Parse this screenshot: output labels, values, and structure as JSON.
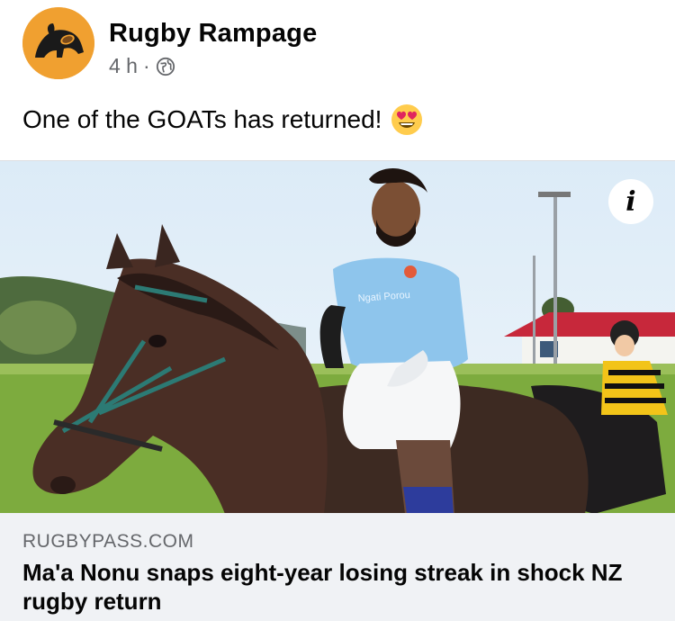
{
  "post": {
    "author": "Rugby Rampage",
    "time": "4 h",
    "separator": "·",
    "privacy_icon": "globe-icon",
    "text": "One of the GOATs has returned!",
    "emoji": "heart-eyes-emoji"
  },
  "photo": {
    "info_label": "i",
    "jersey_text": "Ngati Porou"
  },
  "link": {
    "domain": "RUGBYPASS.COM",
    "headline": "Ma'a Nonu snaps eight-year losing streak in shock NZ rugby return"
  },
  "colors": {
    "avatar_bg": "#f0a030",
    "link_card_bg": "#f0f2f5",
    "secondary_text": "#65676b"
  }
}
